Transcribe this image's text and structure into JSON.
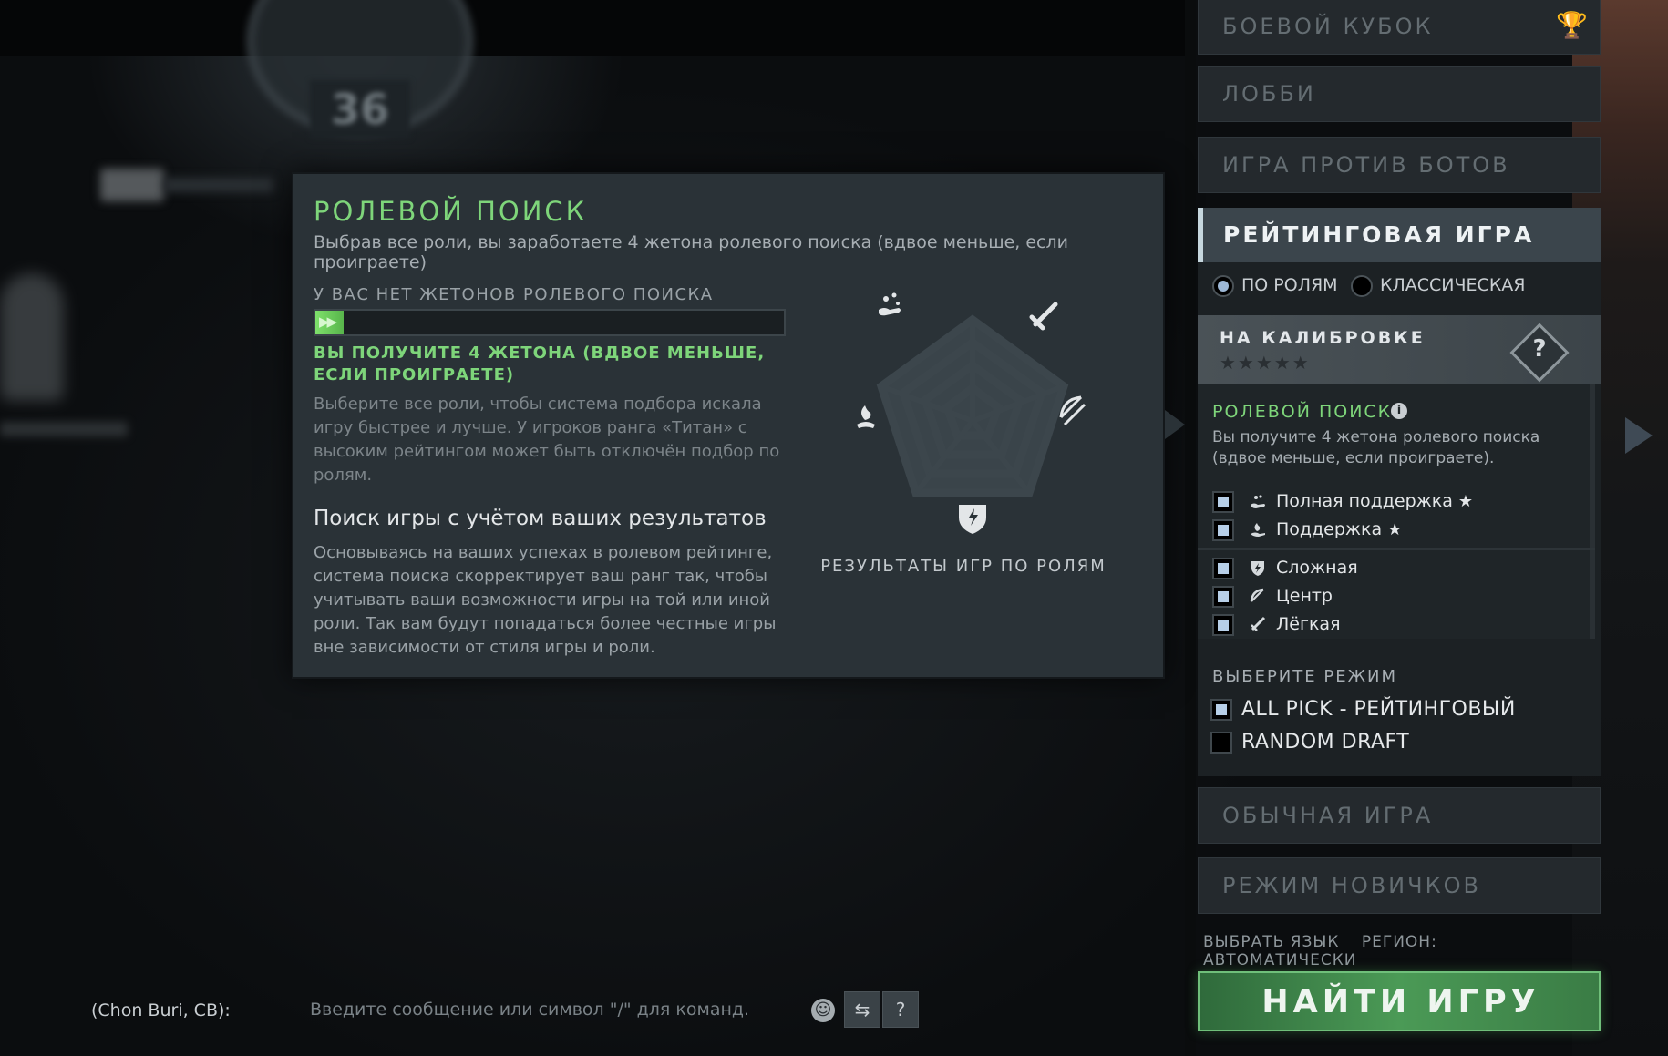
{
  "background": {
    "level": "36"
  },
  "tooltip": {
    "title": "РОЛЕВОЙ ПОИСК",
    "subtitle": "Выбрав все роли, вы заработаете 4 жетона ролевого поиска (вдвое меньше, если проиграете)",
    "no_tokens": "У ВАС НЕТ ЖЕТОНОВ РОЛЕВОГО ПОИСКА",
    "progress_fraction": 0.06,
    "you_get": "ВЫ ПОЛУЧИТЕ 4 ЖЕТОНА (ВДВОЕ МЕНЬШЕ, ЕСЛИ ПРОИГРАЕТЕ)",
    "desc1": "Выберите все роли, чтобы система подбора искала игру быстрее и лучше. У игроков ранга «Титан» с высоким рейтингом может быть отключён подбор по ролям.",
    "heading2": "Поиск игры с учётом ваших результатов",
    "desc2": "Основываясь на ваших успехах в ролевом рейтинге, система поиска скорректирует ваш ранг так, чтобы учитывать ваши возможности игры на той или иной роли. Так вам будут попадаться более честные игры вне зависимости от стиля игры и роли.",
    "radar_label": "РЕЗУЛЬТАТЫ ИГР ПО РОЛЯМ",
    "radar_icons": [
      "hard-support-icon",
      "carry-icon",
      "mid-icon",
      "offlane-icon",
      "support-icon"
    ]
  },
  "modes": {
    "battle_cup": "БОЕВОЙ КУБОК",
    "lobby": "ЛОББИ",
    "bots": "ИГРА ПРОТИВ БОТОВ",
    "ranked": "РЕЙТИНГОВАЯ ИГРА",
    "normal": "ОБЫЧНАЯ ИГРА",
    "newbie": "РЕЖИМ НОВИЧКОВ"
  },
  "ranked": {
    "radio_roles": "ПО РОЛЯМ",
    "radio_classic": "КЛАССИЧЕСКАЯ",
    "calibration": "НА КАЛИБРОВКЕ",
    "calibration_stars": "★★★★★",
    "calibration_badge": "?",
    "role_title": "РОЛЕВОЙ ПОИСК",
    "role_info": "i",
    "role_sub": "Вы получите 4 жетона ролевого поиска (вдвое меньше, если проиграете).",
    "roles": [
      {
        "label": "Полная поддержка",
        "star": "★",
        "checked": true
      },
      {
        "label": "Поддержка",
        "star": "★",
        "checked": true
      },
      {
        "label": "Сложная",
        "star": "",
        "checked": true
      },
      {
        "label": "Центр",
        "star": "",
        "checked": true
      },
      {
        "label": "Лёгкая",
        "star": "",
        "checked": true
      }
    ],
    "select_mode": "ВЫБЕРИТЕ РЕЖИМ",
    "game_modes": [
      {
        "label": "ALL PICK - РЕЙТИНГОВЫЙ",
        "checked": true
      },
      {
        "label": "RANDOM DRAFT",
        "checked": false
      }
    ]
  },
  "footer": {
    "language": "ВЫБРАТЬ ЯЗЫК",
    "region": "РЕГИОН: АВТОМАТИЧЕСКИ",
    "find_game": "НАЙТИ ИГРУ"
  },
  "chat": {
    "prefix": "(Chon Buri, CB):",
    "placeholder": "Введите сообщение или символ \"/\" для команд.",
    "help": "?"
  },
  "colors": {
    "accent_green": "#7ed57a",
    "find_button": "#4b9a56",
    "panel_bg": "#2a3237"
  }
}
